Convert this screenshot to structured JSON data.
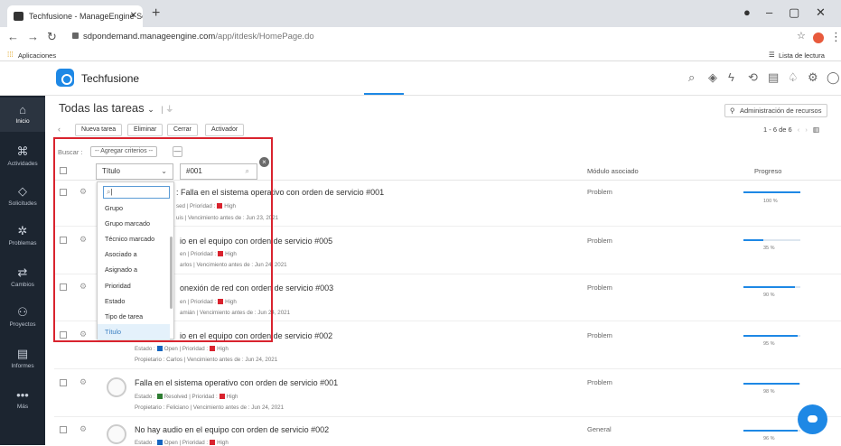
{
  "browser": {
    "tab_title": "Techfusione - ManageEngine Ser",
    "url_host": "sdpondemand.manageengine.com",
    "url_path": "/app/itdesk/HomePage.do",
    "bookmarks_label": "Aplicaciones",
    "reading_list_label": "Lista de lectura"
  },
  "app": {
    "brand": "Techfusione",
    "accent": "#1e88e5"
  },
  "nav": [
    {
      "label": "Inicio",
      "icon": "home-icon"
    },
    {
      "label": "Actividades",
      "icon": "activities-icon"
    },
    {
      "label": "Solicitudes",
      "icon": "requests-icon"
    },
    {
      "label": "Problemas",
      "icon": "problems-icon"
    },
    {
      "label": "Cambios",
      "icon": "changes-icon"
    },
    {
      "label": "Proyectos",
      "icon": "projects-icon"
    },
    {
      "label": "Informes",
      "icon": "reports-icon"
    },
    {
      "label": "Más",
      "icon": "more-icon"
    }
  ],
  "page": {
    "title": "Todas las tareas",
    "buttons": {
      "new": "Nueva tarea",
      "delete": "Eliminar",
      "close": "Cerrar",
      "trigger": "Activador"
    },
    "resources_button": "Administración de recursos",
    "pager": "1 - 6 de 6",
    "columns": {
      "module": "Módulo asociado",
      "progress": "Progreso"
    }
  },
  "filter": {
    "search_label": "Buscar :",
    "criteria_button": "-- Agregar criterios --",
    "minus": "—",
    "field_value": "Título",
    "value_text": "#001",
    "options": [
      "Grupo",
      "Grupo marcado",
      "Técnico marcado",
      "Asociado a",
      "Asignado a",
      "Prioridad",
      "Estado",
      "Tipo de tarea",
      "Título"
    ],
    "selected_option": "Título"
  },
  "rows": [
    {
      "title": "Falla en el sistema operativo con orden de servicio #001",
      "title_visible": ": Falla en el sistema operativo con orden de servicio #001",
      "status": "Resolved",
      "status_visible": "sed",
      "status_color": "#2e7d32",
      "priority": "High",
      "owner": "Luis",
      "owner_visible": "uis",
      "due": "Jun 23, 2021",
      "module": "Problem",
      "progress_label": "100 %",
      "progress": 1.0
    },
    {
      "title": "No hay audio en el equipo con orden de servicio #005",
      "title_visible": "io en el equipo con orden de servicio #005",
      "status": "Open",
      "status_visible": "en",
      "status_color": "#1565c0",
      "priority": "High",
      "owner": "Carlos",
      "owner_visible": "arlos",
      "due": "Jun 24, 2021",
      "module": "Problem",
      "progress_label": "35 %",
      "progress": 0.35
    },
    {
      "title": "Sin conexión de red con orden de servicio #003",
      "title_visible": "onexión de red con orden de servicio #003",
      "status": "Open",
      "status_visible": "en",
      "status_color": "#1565c0",
      "priority": "High",
      "owner": "Damián",
      "owner_visible": "amián",
      "due": "Jun 24, 2021",
      "module": "Problem",
      "progress_label": "90 %",
      "progress": 0.9
    },
    {
      "title": "No hay audio en el equipo con orden de servicio #002",
      "title_visible": "io en el equipo con orden de servicio #002",
      "status": "Open",
      "status_color": "#1565c0",
      "priority": "High",
      "owner": "Carlos",
      "due": "Jun 24, 2021",
      "module": "Problem",
      "progress_label": "95 %",
      "progress": 0.95
    },
    {
      "title": "Falla en el sistema operativo con orden de servicio #001",
      "status": "Resolved",
      "status_color": "#2e7d32",
      "priority": "High",
      "owner": "Feliciano",
      "due": "Jun 24, 2021",
      "module": "Problem",
      "progress_label": "98 %",
      "progress": 0.98
    },
    {
      "title": "No hay audio en el equipo con orden de servicio #002",
      "status": "Open",
      "status_color": "#1565c0",
      "priority": "High",
      "module": "General",
      "progress_label": "96 %",
      "progress": 0.96
    }
  ],
  "labels": {
    "estado": "Estado :",
    "prioridad": "Prioridad :",
    "propietario": "Propietario :",
    "vencimiento": "Vencimiento antes de :"
  },
  "colors": {
    "priority_high": "#d9232e",
    "filter_outline": "#d9232e",
    "nav_bg": "#1c2530"
  }
}
